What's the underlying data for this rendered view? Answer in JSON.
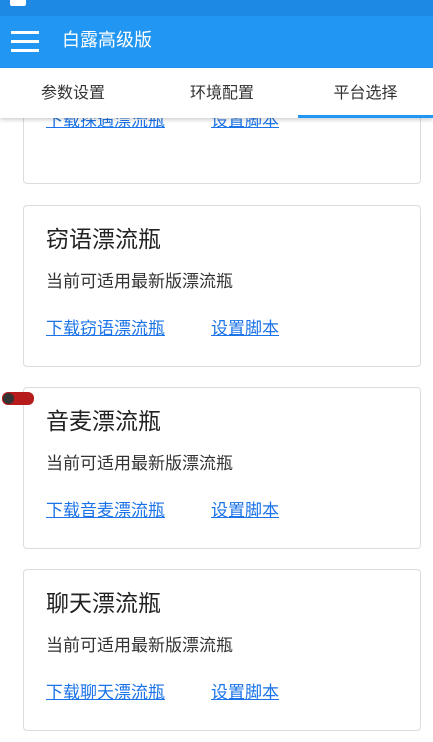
{
  "app": {
    "title": "白露高级版"
  },
  "tabs": [
    {
      "label": "参数设置"
    },
    {
      "label": "环境配置"
    },
    {
      "label": "平台选择"
    }
  ],
  "cards": [
    {
      "download_label": "下载探遇漂流瓶",
      "script_label": "设置脚本"
    },
    {
      "name": "窃语漂流瓶",
      "desc": "当前可适用最新版漂流瓶",
      "download_label": "下载窃语漂流瓶",
      "script_label": "设置脚本"
    },
    {
      "name": "音麦漂流瓶",
      "desc": "当前可适用最新版漂流瓶",
      "download_label": "下载音麦漂流瓶",
      "script_label": "设置脚本"
    },
    {
      "name": "聊天漂流瓶",
      "desc": "当前可适用最新版漂流瓶",
      "download_label": "下载聊天漂流瓶",
      "script_label": "设置脚本"
    }
  ],
  "colors": {
    "appbar": "#2196f3",
    "statusbar": "#1e88e5",
    "link": "#1a73e8"
  }
}
